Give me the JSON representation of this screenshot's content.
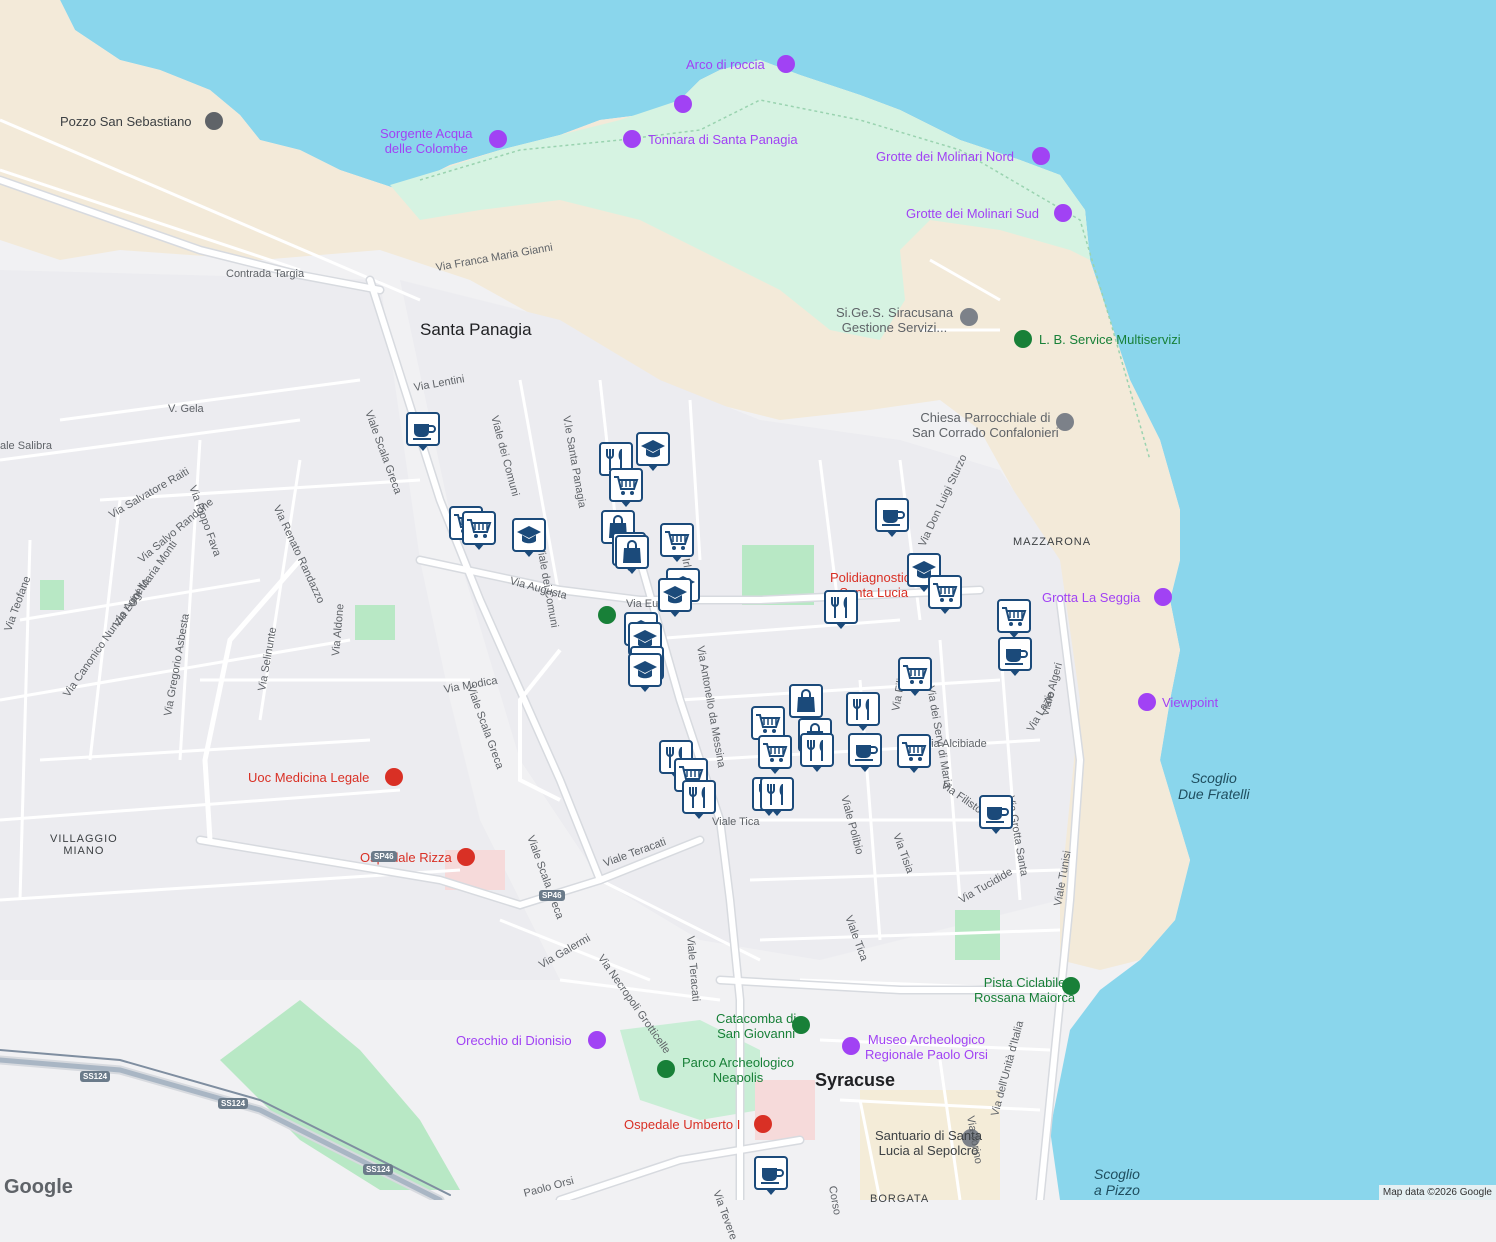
{
  "colors": {
    "water": "#8ad6ec",
    "land": "#f1f1f3",
    "sand": "#f3ead9",
    "park": "#d6f3e2",
    "green": "#b8e8c5",
    "road": "#ffffff",
    "road_casing": "#d7dadf",
    "marker_border": "#1b4a7a",
    "marker_icon": "#1b4a7a"
  },
  "labels": {
    "places": [
      {
        "id": "santa-panagia",
        "text": "Santa Panagia"
      },
      {
        "id": "villaggio-miano",
        "text": "VILLAGGIO\nMIANO"
      },
      {
        "id": "syracuse",
        "text": "Syracuse"
      },
      {
        "id": "mazzarona",
        "text": "MAZZARONA"
      },
      {
        "id": "borgata",
        "text": "BORGATA"
      }
    ],
    "pois": [
      {
        "id": "arco-di-roccia",
        "text": "Arco di roccia",
        "kind": "purple"
      },
      {
        "id": "pozzo-san-sebastiano",
        "text": "Pozzo San Sebastiano",
        "kind": "dark"
      },
      {
        "id": "sorgente",
        "text": "Sorgente Acqua\ndelle Colombe",
        "kind": "purple"
      },
      {
        "id": "tonnara",
        "text": "Tonnara di Santa Panagia",
        "kind": "purple"
      },
      {
        "id": "grotte-nord",
        "text": "Grotte dei Molinari Nord",
        "kind": "purple"
      },
      {
        "id": "grotte-sud",
        "text": "Grotte dei Molinari Sud",
        "kind": "purple"
      },
      {
        "id": "sigess",
        "text": "Si.Ge.S. Siracusana\nGestione Servizi...",
        "kind": "gray"
      },
      {
        "id": "lb-service",
        "text": "L. B. Service Multiservizi",
        "kind": "green"
      },
      {
        "id": "chiesa",
        "text": "Chiesa Parrocchiale di\nSan Corrado Confalonieri",
        "kind": "gray"
      },
      {
        "id": "grotta-seggia",
        "text": "Grotta La Seggia",
        "kind": "purple"
      },
      {
        "id": "viewpoint",
        "text": "Viewpoint",
        "kind": "purple"
      },
      {
        "id": "uoc",
        "text": "Uoc Medicina Legale",
        "kind": "red"
      },
      {
        "id": "rizza",
        "text": "Ospedale Rizza",
        "kind": "red"
      },
      {
        "id": "policlinica",
        "text": "Polidiagnostica\nSanta Lucia",
        "kind": "red"
      },
      {
        "id": "pista",
        "text": "Pista Ciclabile\nRossana Maiorca",
        "kind": "green"
      },
      {
        "id": "catacomba",
        "text": "Catacomba di\nSan Giovanni",
        "kind": "green"
      },
      {
        "id": "museo",
        "text": "Museo Archeologico\nRegionale Paolo Orsi",
        "kind": "purple"
      },
      {
        "id": "orecchio",
        "text": "Orecchio di Dionisio",
        "kind": "purple"
      },
      {
        "id": "parco",
        "text": "Parco Archeologico\nNeapolis",
        "kind": "green"
      },
      {
        "id": "umberto",
        "text": "Ospedale Umberto I",
        "kind": "red"
      },
      {
        "id": "santuario",
        "text": "Santuario di Santa\nLucia al Sepolcro",
        "kind": "dark"
      }
    ],
    "sea": [
      {
        "id": "scoglio-due",
        "text": "Scoglio\nDue Fratelli"
      },
      {
        "id": "scoglio-pizzo",
        "text": "Scoglio\na Pizzo"
      }
    ],
    "streets": [
      {
        "id": "contrada-targia",
        "text": "Contrada Targia"
      },
      {
        "id": "via-franca",
        "text": "Via Franca Maria Gianni"
      },
      {
        "id": "via-lentini",
        "text": "Via Lentini"
      },
      {
        "id": "v-gela",
        "text": "V. Gela"
      },
      {
        "id": "viale-salibra",
        "text": "ale Salibra"
      },
      {
        "id": "via-salvatore",
        "text": "Via Salvatore Raiti"
      },
      {
        "id": "via-salvo",
        "text": "Via Salvo Randone"
      },
      {
        "id": "via-pippo",
        "text": "Via Pippo Fava"
      },
      {
        "id": "via-renato",
        "text": "Via Renato Randazzo"
      },
      {
        "id": "via-luigi",
        "text": "Via Luigi Maria Monti"
      },
      {
        "id": "via-canonico",
        "text": "Via Canonico Nunzio Agnello"
      },
      {
        "id": "via-gregorio",
        "text": "Via Gregorio Asbesta"
      },
      {
        "id": "via-teofane",
        "text": "Via Teofane"
      },
      {
        "id": "via-aldone",
        "text": "Via Aldone"
      },
      {
        "id": "via-selinunte",
        "text": "Via Selinunte"
      },
      {
        "id": "via-modica",
        "text": "Via Modica"
      },
      {
        "id": "via-augusta",
        "text": "Via Augusta"
      },
      {
        "id": "viale-scala-greca-1",
        "text": "Viale Scala Greca"
      },
      {
        "id": "viale-scala-greca-2",
        "text": "Viale Scala Greca"
      },
      {
        "id": "viale-scala-greca-3",
        "text": "Viale Scala Greca"
      },
      {
        "id": "viale-dei-comuni-1",
        "text": "Viale dei Comuni"
      },
      {
        "id": "viale-dei-comuni-2",
        "text": "Viale dei Comuni"
      },
      {
        "id": "via-santa-panagia",
        "text": "V.le Santa Panagia"
      },
      {
        "id": "via-irlanda",
        "text": "Via Irlanda"
      },
      {
        "id": "via-europa",
        "text": "Via Europa"
      },
      {
        "id": "via-antonello",
        "text": "Via Antonello da Messina"
      },
      {
        "id": "viale-teracati-1",
        "text": "Viale Teracati"
      },
      {
        "id": "viale-teracati-2",
        "text": "Viale Teracati"
      },
      {
        "id": "via-necropoli",
        "text": "Via Necropoli Grotticelle"
      },
      {
        "id": "via-galermi",
        "text": "Via Galermi"
      },
      {
        "id": "viale-tica-1",
        "text": "Viale Tica"
      },
      {
        "id": "viale-tica-2",
        "text": "Viale Tica"
      },
      {
        "id": "viale-polibio",
        "text": "Viale Polibio"
      },
      {
        "id": "via-tisia",
        "text": "Via Tisia"
      },
      {
        "id": "via-filisto",
        "text": "Via Filisto"
      },
      {
        "id": "via-alcibiade",
        "text": "Via Alcibiade"
      },
      {
        "id": "via-tucidide",
        "text": "Via Tucidide"
      },
      {
        "id": "via-servi",
        "text": "Via dei Servi di Maria"
      },
      {
        "id": "via-grotta-santa",
        "text": "Via Grotta Santa"
      },
      {
        "id": "via-lazio",
        "text": "Via Lazio"
      },
      {
        "id": "viale-algeri",
        "text": "Viale Algeri"
      },
      {
        "id": "viale-tunisi",
        "text": "Viale Tunisi"
      },
      {
        "id": "via-torino",
        "text": "Via Torino"
      },
      {
        "id": "via-unita",
        "text": "Via dell'Unità d'Italia"
      },
      {
        "id": "via-don-luigi",
        "text": "Via Don Luigi Sturzo"
      },
      {
        "id": "via-tevere",
        "text": "Via Tevere"
      },
      {
        "id": "corso",
        "text": "Corso"
      },
      {
        "id": "paolo-orsi",
        "text": "Paolo Orsi"
      },
      {
        "id": "via-fili",
        "text": "Via Fili"
      }
    ],
    "shields": [
      "SP46",
      "SP46",
      "SS124",
      "SS124",
      "SS124"
    ]
  },
  "markers": [
    {
      "icon": "cafe-icon"
    },
    {
      "icon": "grocery-icon"
    },
    {
      "icon": "grocery-icon"
    },
    {
      "icon": "school-icon"
    },
    {
      "icon": "restaurant-icon"
    },
    {
      "icon": "school-icon"
    },
    {
      "icon": "grocery-icon"
    },
    {
      "icon": "shopping-icon"
    },
    {
      "icon": "shopping-icon"
    },
    {
      "icon": "grocery-icon"
    },
    {
      "icon": "shopping-icon"
    },
    {
      "icon": "school-icon"
    },
    {
      "icon": "school-icon"
    },
    {
      "icon": "school-icon"
    },
    {
      "icon": "school-icon"
    },
    {
      "icon": "school-icon"
    },
    {
      "icon": "school-icon"
    },
    {
      "icon": "cafe-icon"
    },
    {
      "icon": "school-icon"
    },
    {
      "icon": "restaurant-icon"
    },
    {
      "icon": "grocery-icon"
    },
    {
      "icon": "grocery-icon"
    },
    {
      "icon": "cafe-icon"
    },
    {
      "icon": "grocery-icon"
    },
    {
      "icon": "shopping-icon"
    },
    {
      "icon": "restaurant-icon"
    },
    {
      "icon": "grocery-icon"
    },
    {
      "icon": "restaurant-icon"
    },
    {
      "icon": "shopping-icon"
    },
    {
      "icon": "restaurant-icon"
    },
    {
      "icon": "cafe-icon"
    },
    {
      "icon": "grocery-icon"
    },
    {
      "icon": "grocery-icon"
    },
    {
      "icon": "restaurant-icon"
    },
    {
      "icon": "grocery-icon"
    },
    {
      "icon": "restaurant-icon"
    },
    {
      "icon": "restaurant-icon"
    },
    {
      "icon": "cafe-icon"
    },
    {
      "icon": "cafe-icon"
    }
  ],
  "attribution": {
    "logo": "Google",
    "text": "Map data ©2026 Google"
  }
}
